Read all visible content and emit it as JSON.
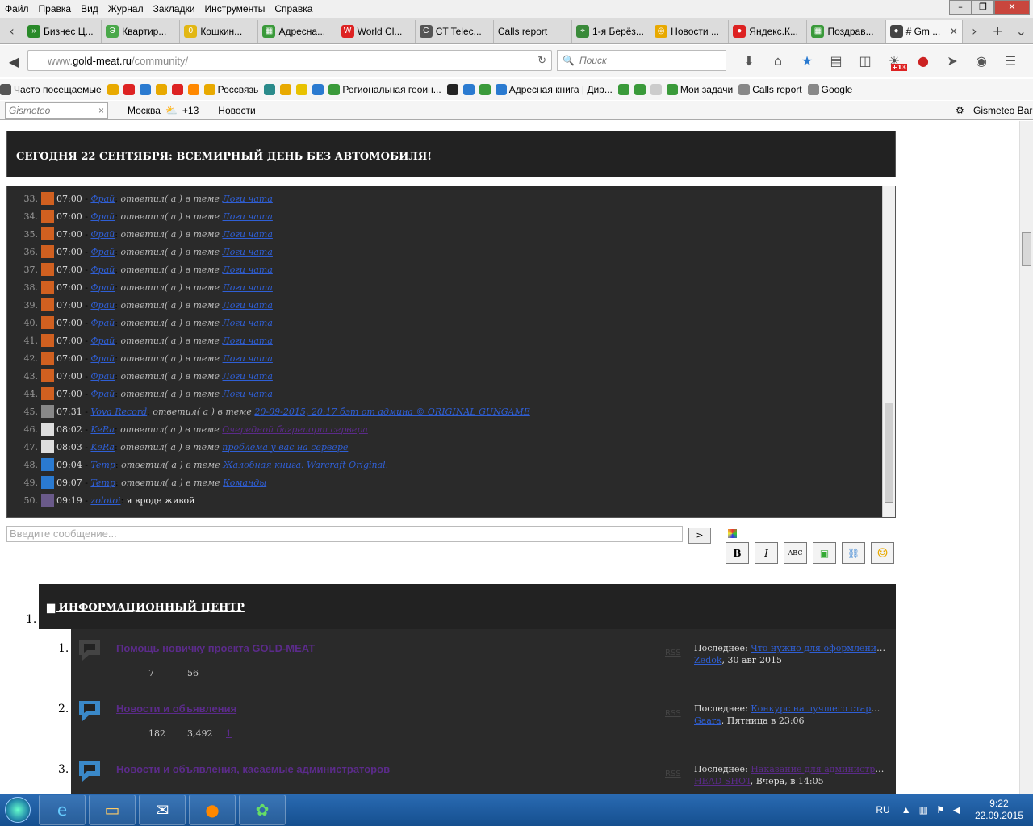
{
  "menubar": {
    "items": [
      "Файл",
      "Правка",
      "Вид",
      "Журнал",
      "Закладки",
      "Инструменты",
      "Справка"
    ]
  },
  "tabs": [
    {
      "label": "Бизнес Ц...",
      "color": "#2a8a2a",
      "glyph": "»"
    },
    {
      "label": "Квартир...",
      "color": "#4aa84a",
      "glyph": "Э"
    },
    {
      "label": "Кошкин...",
      "color": "#e2b714",
      "glyph": "0"
    },
    {
      "label": "Адресна...",
      "color": "#3a9a3a",
      "glyph": "▦"
    },
    {
      "label": "World Cl...",
      "color": "#d22",
      "glyph": "W"
    },
    {
      "label": "CT Telec...",
      "color": "#555",
      "glyph": "C"
    },
    {
      "label": "Calls report",
      "color": "",
      "glyph": ""
    },
    {
      "label": "1-я Берёз...",
      "color": "#3a8a3a",
      "glyph": "⌖"
    },
    {
      "label": "Новости ...",
      "color": "#e8a900",
      "glyph": "◎"
    },
    {
      "label": "Яндекс.К...",
      "color": "#d22",
      "glyph": "●"
    },
    {
      "label": "Поздрав...",
      "color": "#3a9a3a",
      "glyph": "▦"
    },
    {
      "label": "# Gm ...",
      "color": "#444",
      "glyph": "●",
      "active": true
    }
  ],
  "nav": {
    "url_prefix": "www.",
    "url_domain": "gold-meat.ru",
    "url_path": "/community/",
    "search_placeholder": "Поиск",
    "weather_badge": "+13"
  },
  "bookmarks": [
    "Часто посещаемые",
    "Россвязь",
    "Региональная геоин...",
    "Адресная книга | Дир...",
    "Мои задачи",
    "Calls report",
    "Google"
  ],
  "gismeteo": {
    "search": "Gismeteo",
    "city": "Москва",
    "temp": "+13",
    "news": "Новости",
    "bar": "Gismeteo Bar"
  },
  "announcement": "СЕГОДНЯ 22 СЕНТЯБРЯ: ВСЕМИРНЫЙ ДЕНЬ БЕЗ АВТОМОБИЛЯ!",
  "chat": {
    "rows": [
      {
        "n": "33.",
        "t": "07:00",
        "u": "Фрай",
        "a": "ответил( а ) в теме",
        "tp": "Логи чата",
        "av": "#d06020"
      },
      {
        "n": "34.",
        "t": "07:00",
        "u": "Фрай",
        "a": "ответил( а ) в теме",
        "tp": "Логи чата",
        "av": "#d06020"
      },
      {
        "n": "35.",
        "t": "07:00",
        "u": "Фрай",
        "a": "ответил( а ) в теме",
        "tp": "Логи чата",
        "av": "#d06020"
      },
      {
        "n": "36.",
        "t": "07:00",
        "u": "Фрай",
        "a": "ответил( а ) в теме",
        "tp": "Логи чата",
        "av": "#d06020"
      },
      {
        "n": "37.",
        "t": "07:00",
        "u": "Фрай",
        "a": "ответил( а ) в теме",
        "tp": "Логи чата",
        "av": "#d06020"
      },
      {
        "n": "38.",
        "t": "07:00",
        "u": "Фрай",
        "a": "ответил( а ) в теме",
        "tp": "Логи чата",
        "av": "#d06020"
      },
      {
        "n": "39.",
        "t": "07:00",
        "u": "Фрай",
        "a": "ответил( а ) в теме",
        "tp": "Логи чата",
        "av": "#d06020"
      },
      {
        "n": "40.",
        "t": "07:00",
        "u": "Фрай",
        "a": "ответил( а ) в теме",
        "tp": "Логи чата",
        "av": "#d06020"
      },
      {
        "n": "41.",
        "t": "07:00",
        "u": "Фрай",
        "a": "ответил( а ) в теме",
        "tp": "Логи чата",
        "av": "#d06020"
      },
      {
        "n": "42.",
        "t": "07:00",
        "u": "Фрай",
        "a": "ответил( а ) в теме",
        "tp": "Логи чата",
        "av": "#d06020"
      },
      {
        "n": "43.",
        "t": "07:00",
        "u": "Фрай",
        "a": "ответил( а ) в теме",
        "tp": "Логи чата",
        "av": "#d06020"
      },
      {
        "n": "44.",
        "t": "07:00",
        "u": "Фрай",
        "a": "ответил( а ) в теме",
        "tp": "Логи чата",
        "av": "#d06020"
      },
      {
        "n": "45.",
        "t": "07:31",
        "u": "Vova Record",
        "a": "ответил( а ) в теме",
        "tp": "20-09-2015, 20:17 бэт от админа © ORIGINAL GUNGAME",
        "av": "#888"
      },
      {
        "n": "46.",
        "t": "08:02",
        "u": "KeRa",
        "a": "ответил( а ) в теме",
        "tp": "Очередной багрепорт сервера",
        "av": "#ddd",
        "visited": true
      },
      {
        "n": "47.",
        "t": "08:03",
        "u": "KeRa",
        "a": "ответил( а ) в теме",
        "tp": "проблема у вас на сервере",
        "av": "#ddd"
      },
      {
        "n": "48.",
        "t": "09:04",
        "u": "Temp",
        "a": "ответил( а ) в теме",
        "tp": "Жалобная книга. Warcraft Original.",
        "av": "#2a7ad0"
      },
      {
        "n": "49.",
        "t": "09:07",
        "u": "Temp",
        "a": "ответил( а ) в теме",
        "tp": "Команды",
        "av": "#2a7ad0"
      },
      {
        "n": "50.",
        "t": "09:19",
        "u": "zolotoi",
        "a": "",
        "tp": "",
        "msg": "я вроде живой",
        "av": "#6a5a8a"
      }
    ]
  },
  "composer": {
    "placeholder": "Введите сообщение...",
    "send": ">",
    "bold": "B",
    "italic": "I",
    "strike": "ABC"
  },
  "forum": {
    "category_num": "1.",
    "category": "ИНФОРМАЦИОННЫЙ ЦЕНТР",
    "forums": [
      {
        "n": "1.",
        "title": "Помощь новичку проекта GOLD-MEAT",
        "s1": "7",
        "s2": "56",
        "s3": "",
        "last_label": "Последнее:",
        "last_topic": "Что нужно для оформления ...",
        "last_user": "Zedok",
        "last_time": ", 30 авг 2015",
        "icon": "#444",
        "visited": false
      },
      {
        "n": "2.",
        "title": "Новости и объявления",
        "s1": "182",
        "s2": "3,492",
        "s3": "1",
        "last_label": "Последнее:",
        "last_topic": "Конкурс на лучшего старше...",
        "last_user": "Gaara",
        "last_time": ", Пятница в 23:06",
        "icon": "#3a88c8",
        "visited": false
      },
      {
        "n": "3.",
        "title": "Новости и объявления, касаемые администраторов",
        "s1": "",
        "s2": "",
        "s3": "",
        "last_label": "Последнее:",
        "last_topic": "Наказание для администрат...",
        "last_user": "HEAD SHOT",
        "last_time": ", Вчера, в 14:05",
        "icon": "#3a88c8",
        "visited": true
      }
    ]
  },
  "taskbar": {
    "lang": "RU",
    "time": "9:22",
    "date": "22.09.2015"
  }
}
